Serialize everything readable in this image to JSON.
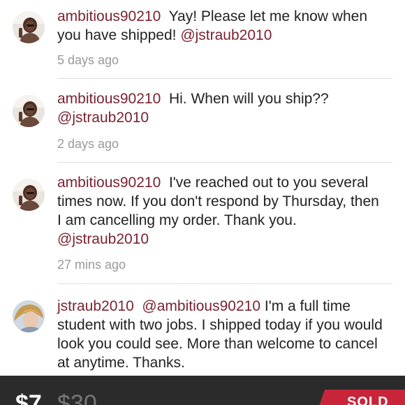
{
  "comments": [
    {
      "username": "ambitious90210",
      "text": "Yay! Please let me know when you have shipped!",
      "mention": "@jstraub2010",
      "time": "5 days ago"
    },
    {
      "username": "ambitious90210",
      "text": "Hi. When will you ship??",
      "mention": "@jstraub2010",
      "time": "2 days ago"
    },
    {
      "username": "ambitious90210",
      "text": "I've reached out to you several times now. If you don't respond by Thursday, then I am cancelling my order. Thank you.",
      "mention": "@jstraub2010",
      "time": "27 mins ago"
    },
    {
      "username": "jstraub2010",
      "mention": "@ambitious90210",
      "text": "I'm a full time student with two jobs. I shipped today if you would look you could see. More than welcome to cancel at anytime. Thanks."
    }
  ],
  "listing": {
    "price": "$7",
    "original_price": "$30",
    "status": "SOLD"
  },
  "colors": {
    "username": "#7a2331",
    "sold_badge": "#c8253a",
    "bottom_bar": "#2b2b2b"
  }
}
